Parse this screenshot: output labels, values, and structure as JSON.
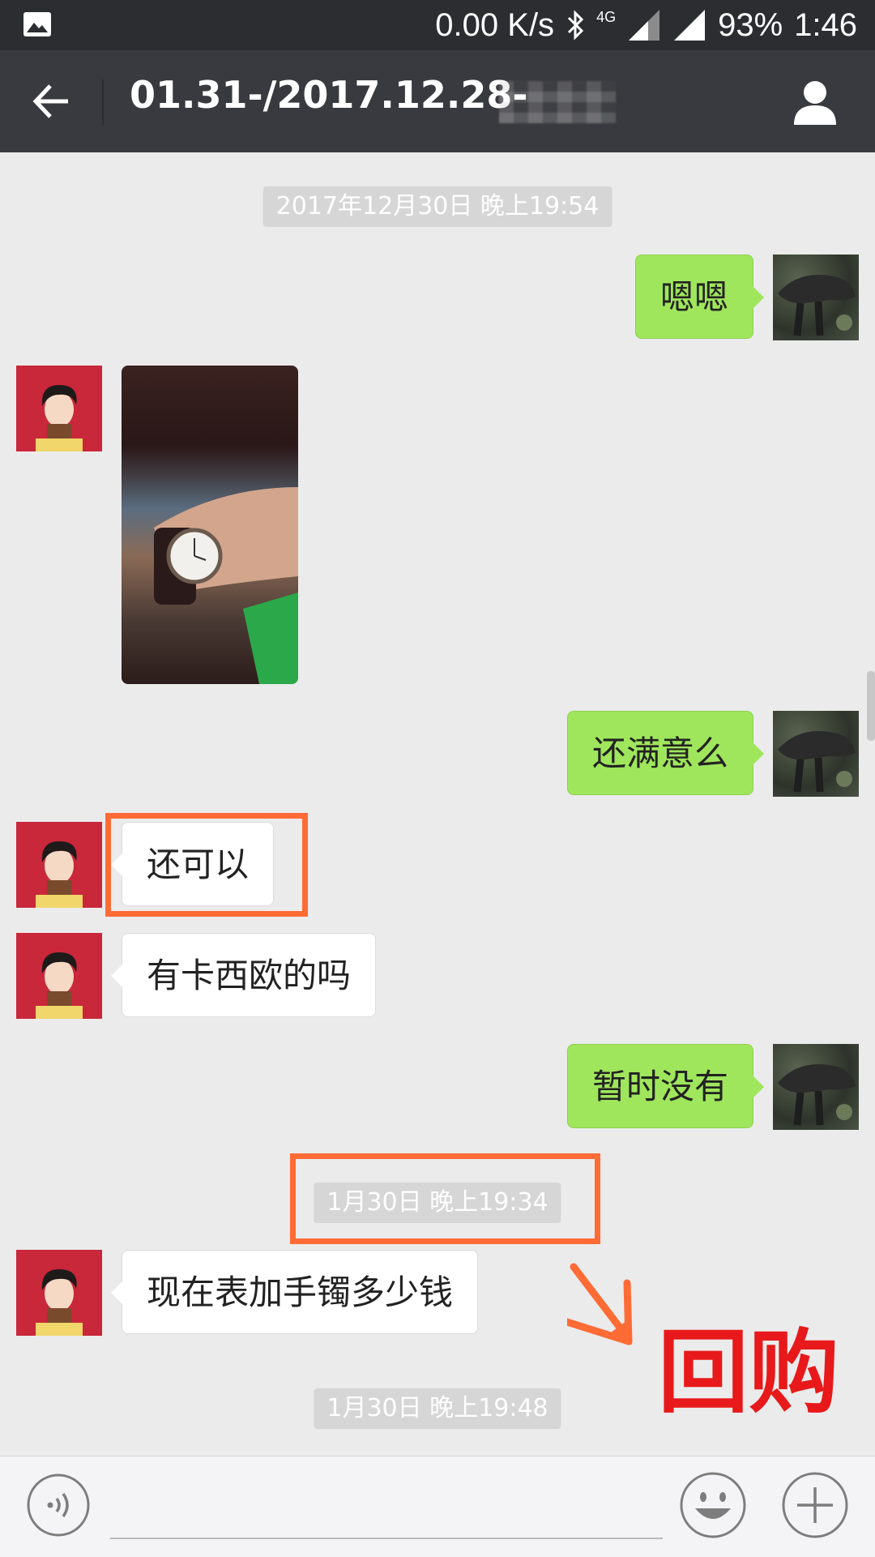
{
  "status_bar": {
    "net_speed": "0.00 K/s",
    "network_type": "4G",
    "battery": "93%",
    "time": "1:46",
    "icons": [
      "gallery-icon",
      "bluetooth-icon",
      "signal-icon",
      "signal-icon"
    ]
  },
  "header": {
    "title": "01.31-/2017.12.28-",
    "back_icon": "arrow-left-icon",
    "profile_icon": "person-icon"
  },
  "messages": {
    "ts1": "2017年12月30日 晚上19:54",
    "m1": "嗯嗯",
    "m3": "还满意么",
    "m4": "还可以",
    "m5": "有卡西欧的吗",
    "m6": "暂时没有",
    "ts2": "1月30日 晚上19:34",
    "m7": "现在表加手镯多少钱",
    "ts3": "1月30日 晚上19:48"
  },
  "annotations": {
    "label": "回购",
    "color": "#ff6b35",
    "label_color": "#e8191a"
  },
  "input_bar": {
    "icons": [
      "voice-icon",
      "emoji-icon",
      "plus-icon"
    ]
  }
}
